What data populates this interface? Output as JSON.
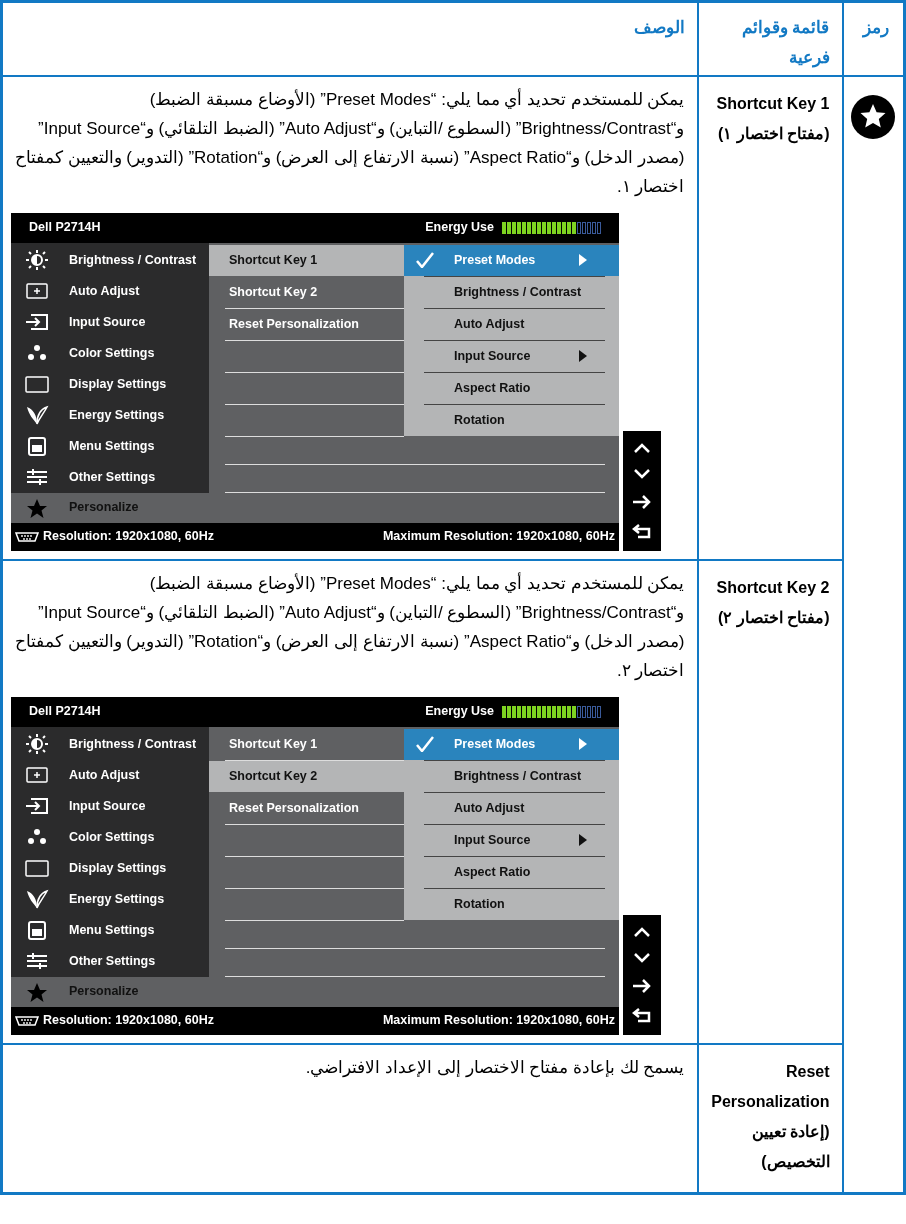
{
  "header": {
    "symbol": "رمز",
    "menu": "قائمة وقوائم فرعية",
    "description": "الوصف"
  },
  "rows": [
    {
      "kind": "osd",
      "menu_label": "Shortcut Key 1 (مفتاح اختصار ١)",
      "description": "يمكن للمستخدم تحديد أي مما يلي: “Preset Modes” (الأوضاع مسبقة الضبط) و“Brightness/Contrast” (السطوع /التباين) و“Auto Adjust” (الضبط التلقائي) و“Input Source” (مصدر الدخل) و“Aspect Ratio” (نسبة الارتفاع إلى العرض) و“Rotation” (التدوير) والتعيين كمفتاح اختصار ١.",
      "osd": {
        "model": "Dell P2714H",
        "energy_label": "Energy Use",
        "energy_meter": {
          "level": 0.76
        },
        "main_menu": [
          {
            "label": "Brightness / Contrast",
            "selected": false
          },
          {
            "label": "Auto Adjust",
            "selected": false
          },
          {
            "label": "Input Source",
            "selected": false
          },
          {
            "label": "Color Settings",
            "selected": false
          },
          {
            "label": "Display Settings",
            "selected": false
          },
          {
            "label": "Energy Settings",
            "selected": false
          },
          {
            "label": "Menu Settings",
            "selected": false
          },
          {
            "label": "Other Settings",
            "selected": false
          },
          {
            "label": "Personalize",
            "selected": true
          }
        ],
        "submenu": [
          {
            "label": "Shortcut Key 1",
            "selected": true
          },
          {
            "label": "Shortcut Key 2",
            "selected": false
          },
          {
            "label": "Reset Personalization",
            "selected": false
          }
        ],
        "options": [
          {
            "label": "Preset Modes",
            "selected": true,
            "has_submenu": true
          },
          {
            "label": "Brightness / Contrast",
            "selected": false,
            "has_submenu": false
          },
          {
            "label": "Auto Adjust",
            "selected": false,
            "has_submenu": false
          },
          {
            "label": "Input Source",
            "selected": false,
            "has_submenu": true
          },
          {
            "label": "Aspect Ratio",
            "selected": false,
            "has_submenu": false
          },
          {
            "label": "Rotation",
            "selected": false,
            "has_submenu": false
          }
        ],
        "resolution": "Resolution: 1920x1080, 60Hz",
        "max_resolution": "Maximum Resolution: 1920x1080, 60Hz"
      }
    },
    {
      "kind": "osd",
      "menu_label": "Shortcut Key 2 (مفتاح اختصار ٢)",
      "description": "يمكن للمستخدم تحديد أي مما يلي: “Preset Modes” (الأوضاع مسبقة الضبط) و“Brightness/Contrast” (السطوع /التباين) و“Auto Adjust” (الضبط التلقائي) و“Input Source” (مصدر الدخل) و“Aspect Ratio” (نسبة الارتفاع إلى العرض) و“Rotation” (التدوير) والتعيين كمفتاح اختصار ٢.",
      "osd": {
        "model": "Dell P2714H",
        "energy_label": "Energy Use",
        "energy_meter": {
          "level": 0.76
        },
        "main_menu": [
          {
            "label": "Brightness / Contrast",
            "selected": false
          },
          {
            "label": "Auto Adjust",
            "selected": false
          },
          {
            "label": "Input Source",
            "selected": false
          },
          {
            "label": "Color Settings",
            "selected": false
          },
          {
            "label": "Display Settings",
            "selected": false
          },
          {
            "label": "Energy Settings",
            "selected": false
          },
          {
            "label": "Menu Settings",
            "selected": false
          },
          {
            "label": "Other Settings",
            "selected": false
          },
          {
            "label": "Personalize",
            "selected": true
          }
        ],
        "submenu": [
          {
            "label": "Shortcut Key 1",
            "selected": false
          },
          {
            "label": "Shortcut Key 2",
            "selected": true
          },
          {
            "label": "Reset Personalization",
            "selected": false
          }
        ],
        "options": [
          {
            "label": "Preset Modes",
            "selected": true,
            "has_submenu": true
          },
          {
            "label": "Brightness / Contrast",
            "selected": false,
            "has_submenu": false
          },
          {
            "label": "Auto Adjust",
            "selected": false,
            "has_submenu": false
          },
          {
            "label": "Input Source",
            "selected": false,
            "has_submenu": true
          },
          {
            "label": "Aspect Ratio",
            "selected": false,
            "has_submenu": false
          },
          {
            "label": "Rotation",
            "selected": false,
            "has_submenu": false
          }
        ],
        "resolution": "Resolution: 1920x1080, 60Hz",
        "max_resolution": "Maximum Resolution: 1920x1080, 60Hz"
      }
    },
    {
      "kind": "text",
      "menu_label": "Reset Personalization (إعادة تعيين التخصيص)",
      "description": "يسمح لك بإعادة مفتاح الاختصار إلى الإعداد الافتراضي."
    }
  ]
}
